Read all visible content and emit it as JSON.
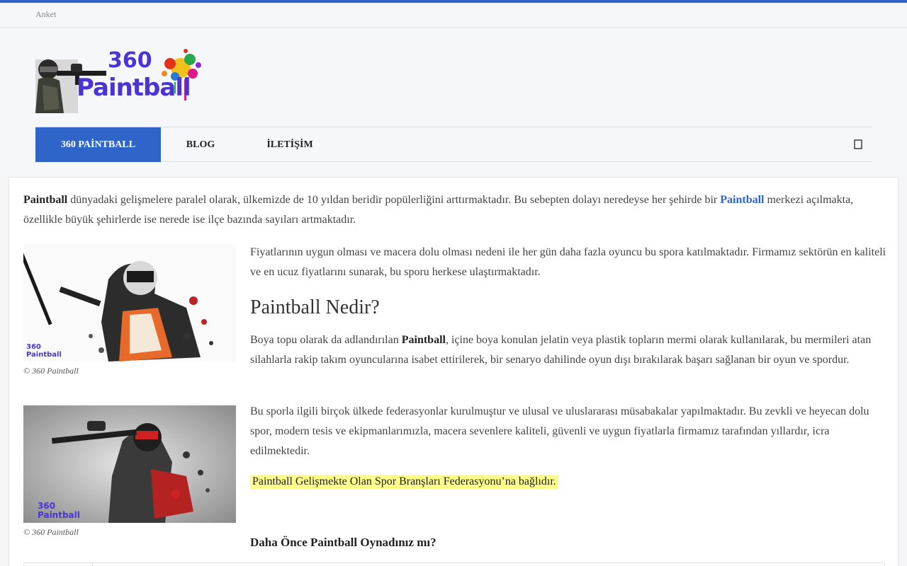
{
  "topbar": {
    "link": "Anket"
  },
  "logo": {
    "number": "360",
    "word": "Paintball"
  },
  "nav": {
    "items": [
      {
        "label": "360 PAİNTBALL",
        "active": true
      },
      {
        "label": "BLOG",
        "active": false
      },
      {
        "label": "İLETİŞİM",
        "active": false
      }
    ],
    "search_icon": "search-icon"
  },
  "article": {
    "intro": {
      "p1_bold": "Paintball",
      "p1_text": " dünyadaki gelişmelere paralel olarak, ülkemizde de 10 yıldan beridir popülerliğini arttırmaktadır. Bu sebepten dolayı neredeyse her şehirde bir ",
      "p1_link": "Paintball",
      "p1_text2": " merkezi açılmakta, özellikle büyük şehirlerde ise nerede ise ilçe bazında sayıları artmaktadır."
    },
    "p2": "Fiyatlarının uygun olması ve macera dolu olması nedeni ile her gün daha fazla oyuncu bu spora katılmaktadır. Firmamız sektörün en kaliteli ve en ucuz fiyatlarını sunarak, bu sporu herkese ulaştırmaktadır.",
    "heading": "Paintball Nedir?",
    "p3_text1": "Boya topu olarak da adlandırılan ",
    "p3_bold": "Paintball",
    "p3_text2": ", içine boya konulan jelatin veya plastik topların mermi olarak kullanılarak, bu mermileri atan silahlarla rakip takım oyuncularına isabet ettirilerek, bir senaryo dahilinde oyun dışı bırakılarak başarı sağlanan bir oyun ve spordur.",
    "p4": "Bu sporla ilgili birçok ülkede federasyonlar kurulmuştur ve ulusal ve uluslararası müsabakalar yapılmaktadır. Bu zevkli ve heyecan dolu spor, modern tesis ve ekipmanlarımızla, macera sevenlere kaliteli, güvenli ve uygun fiyatlarla firmamız tarafından yıllardır, icra edilmektedir.",
    "highlight": "Paintball Gelişmekte Olan Spor Branşları Federasyonu’na bağlıdır.",
    "figures": [
      {
        "caption": "© 360 Paintball",
        "watermark": "360 Paintball"
      },
      {
        "caption": "© 360 Paintball",
        "watermark": "360 Paintball"
      }
    ],
    "poll_title": "Daha Önce Paintball Oynadınız mı?"
  },
  "colors": {
    "accent": "#2f64c9",
    "logo": "#4a35d4",
    "highlight": "#fdfd8a"
  }
}
